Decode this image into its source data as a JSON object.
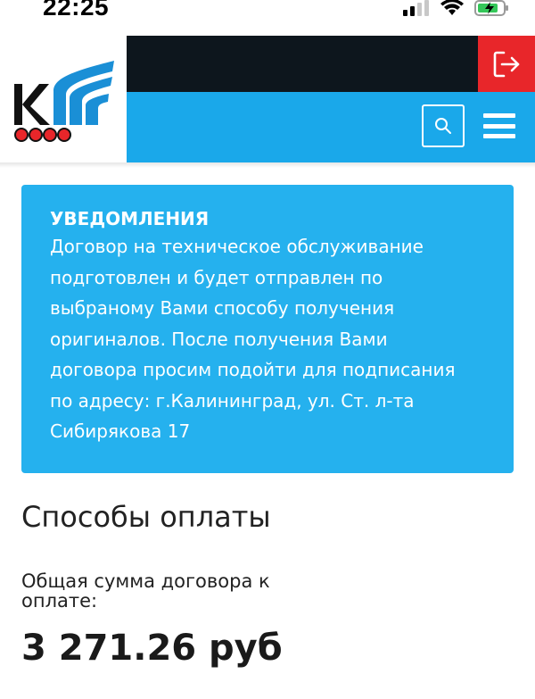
{
  "status_bar": {
    "time": "22:25",
    "icons": [
      "cellular-signal-icon",
      "wifi-icon",
      "battery-charging-icon"
    ]
  },
  "header": {
    "logo_text": "КГ",
    "logo_alt": "company-logo",
    "colors": {
      "dark_bar": "#0d161d",
      "blue_bar": "#1aa8ea",
      "logout": "#e8262a"
    },
    "icons": {
      "logout": "logout-icon",
      "search": "search-icon",
      "menu": "hamburger-menu-icon"
    }
  },
  "notification": {
    "title": "УВЕДОМЛЕНИЯ",
    "lines": [
      "Договор на техническое обслуживание",
      "подготовлен и будет отправлен по",
      "выбраному Вами способу получения",
      "оригиналов. После получения Вами",
      "договора просим подойти для подписания",
      "по адресу: г.Калининград, ул. Ст. л-та",
      "Сибирякова 17"
    ],
    "background": "#25b1ee"
  },
  "payment": {
    "section_title": "Способы оплаты",
    "total_label_lines": [
      "Общая сумма договора к",
      "оплате:"
    ],
    "total_amount": "3 271.26 руб"
  }
}
